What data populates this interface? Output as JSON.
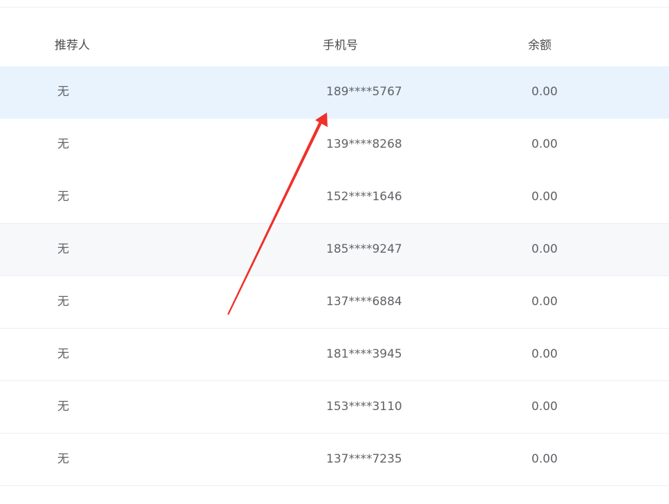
{
  "table": {
    "headers": {
      "referrer": "推荐人",
      "phone": "手机号",
      "balance": "余额"
    },
    "rows": [
      {
        "referrer": "无",
        "phone": "189****5767",
        "balance": "0.00"
      },
      {
        "referrer": "无",
        "phone": "139****8268",
        "balance": "0.00"
      },
      {
        "referrer": "无",
        "phone": "152****1646",
        "balance": "0.00"
      },
      {
        "referrer": "无",
        "phone": "185****9247",
        "balance": "0.00"
      },
      {
        "referrer": "无",
        "phone": "137****6884",
        "balance": "0.00"
      },
      {
        "referrer": "无",
        "phone": "181****3945",
        "balance": "0.00"
      },
      {
        "referrer": "无",
        "phone": "153****3110",
        "balance": "0.00"
      },
      {
        "referrer": "无",
        "phone": "137****7235",
        "balance": "0.00"
      }
    ]
  },
  "colors": {
    "hover_row": "#e8f3fe",
    "striped_row": "#f7f8fa",
    "annotation_arrow": "#f0302a"
  }
}
